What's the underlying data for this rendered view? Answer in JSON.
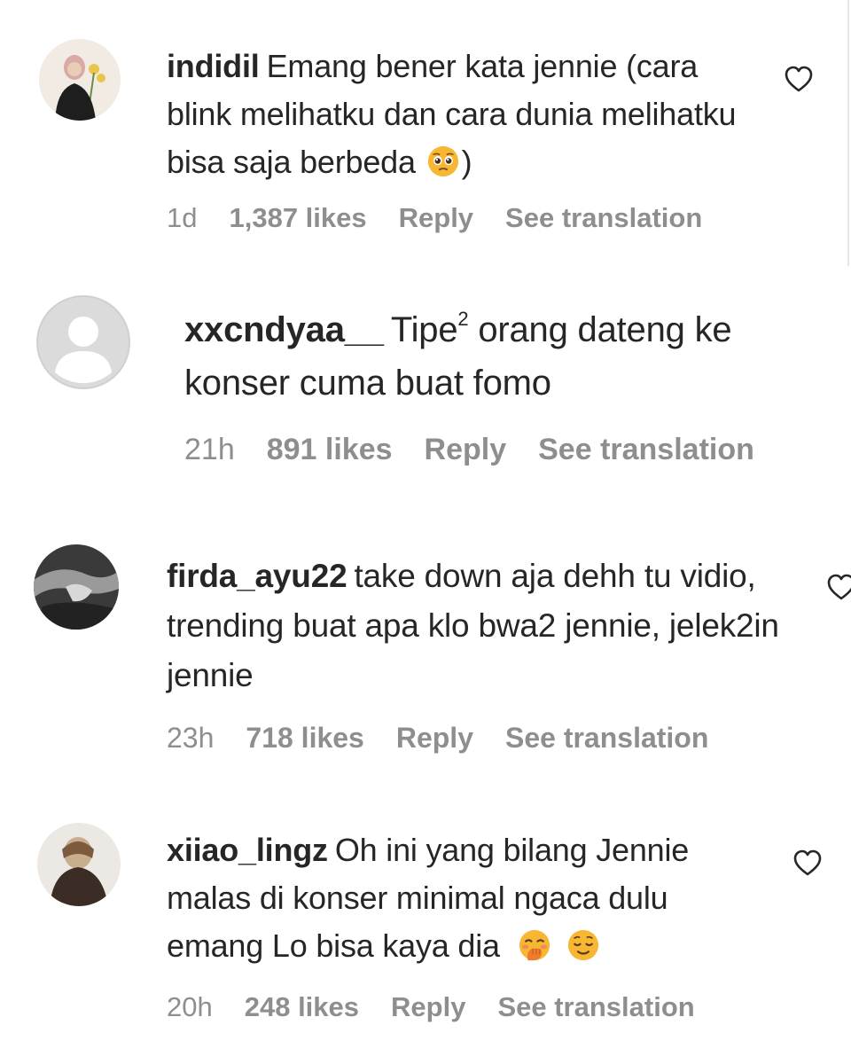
{
  "comments": [
    {
      "username": "indidil",
      "text_parts": [
        "Emang bener kata jennie (cara blink melihatku dan cara dunia melihatku bisa saja berbeda",
        ")"
      ],
      "emojis": [
        "pleading-face-emoji"
      ],
      "time": "1d",
      "likes": "1,387 likes",
      "reply": "Reply",
      "translate": "See translation"
    },
    {
      "username": "xxcndyaa__",
      "text_pre": "Tipe",
      "text_sup": "2",
      "text_post": " orang dateng ke konser cuma buat fomo",
      "time": "21h",
      "likes": "891 likes",
      "reply": "Reply",
      "translate": "See translation"
    },
    {
      "username": "firda_ayu22",
      "text": "take down aja dehh tu vidio, trending buat apa klo bwa2 jennie, jelek2in jennie",
      "time": "23h",
      "likes": "718 likes",
      "reply": "Reply",
      "translate": "See translation"
    },
    {
      "username": "xiiao_lingz",
      "text": "Oh ini yang bilang Jennie malas di konser minimal ngaca dulu emang Lo bisa kaya dia",
      "emojis": [
        "face-with-hand-over-mouth-emoji",
        "relieved-face-emoji"
      ],
      "time": "20h",
      "likes": "248 likes",
      "reply": "Reply",
      "translate": "See translation"
    }
  ],
  "colors": {
    "text": "#262626",
    "meta": "#8e8e8e",
    "emoji_yellow": "#f7b733"
  }
}
